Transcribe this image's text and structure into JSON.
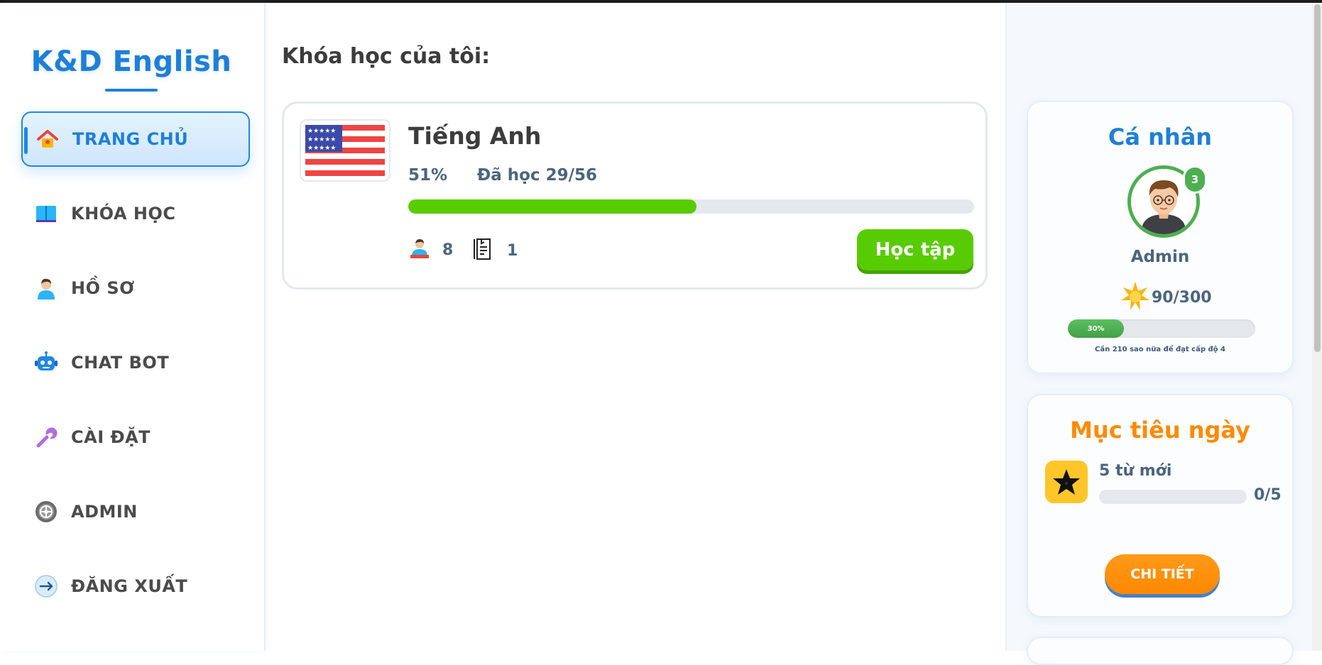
{
  "brand": {
    "name": "K&D English"
  },
  "sidebar": {
    "items": [
      {
        "label": "TRANG CHỦ",
        "icon": "house-icon",
        "active": true
      },
      {
        "label": "KHÓA HỌC",
        "icon": "book-icon",
        "active": false
      },
      {
        "label": "HỒ SƠ",
        "icon": "person-icon",
        "active": false
      },
      {
        "label": "CHAT BOT",
        "icon": "robot-icon",
        "active": false
      },
      {
        "label": "CÀI ĐẶT",
        "icon": "wrench-icon",
        "active": false
      },
      {
        "label": "ADMIN",
        "icon": "gear-icon",
        "active": false
      },
      {
        "label": "ĐĂNG XUẤT",
        "icon": "logout-icon",
        "active": false
      }
    ]
  },
  "main": {
    "title": "Khóa học của tôi:",
    "course": {
      "name": "Tiếng Anh",
      "flag": "us-flag-icon",
      "percent_label": "51%",
      "progress": 0.51,
      "learned_label": "Đã học 29/56",
      "learners_count": "8",
      "lessons_count": "1",
      "study_button": "Học tập"
    }
  },
  "profile": {
    "title": "Cá nhân",
    "level": "3",
    "name": "Admin",
    "stars": "90/300",
    "xp_percent_label": "30%",
    "xp_progress": 0.3,
    "note": "Cần 210 sao nữa để đạt cấp độ 4"
  },
  "daily_goal": {
    "title": "Mục tiêu ngày",
    "goal_label": "5 từ mới",
    "count": "0/5",
    "progress": 0,
    "button": "CHI TIẾT"
  },
  "colors": {
    "brand": "#1e7fd8",
    "success": "#58cc02",
    "accent_orange": "#ff8a00",
    "goal_yellow": "#ffc629"
  }
}
